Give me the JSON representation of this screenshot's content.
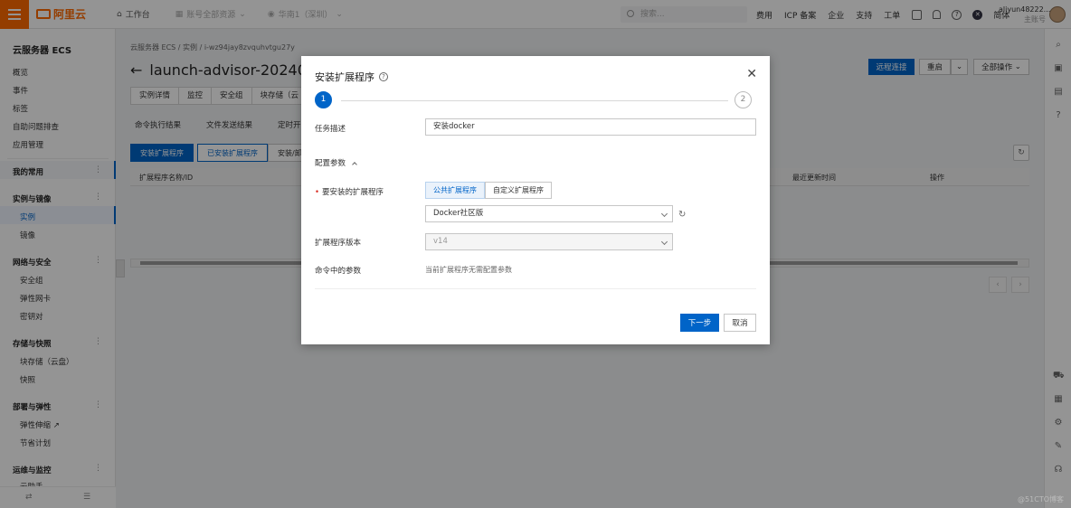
{
  "topbar": {
    "logo": "阿里云",
    "workbench": "工作台",
    "account": "账号全部资源",
    "region": "华南1（深圳）",
    "search_placeholder": "搜索...",
    "links": [
      "费用",
      "ICP 备案",
      "企业",
      "支持",
      "工单"
    ],
    "lang": "简体",
    "user": "aliyun48222...",
    "user_sub": "主账号"
  },
  "sidebar": {
    "title": "云服务器 ECS",
    "top_items": [
      "概览",
      "事件",
      "标签",
      "自助问题排查",
      "应用管理"
    ],
    "groups": [
      {
        "label": "我的常用",
        "items": []
      },
      {
        "label": "实例与镜像",
        "items": [
          "实例",
          "镜像"
        ]
      },
      {
        "label": "网络与安全",
        "items": [
          "安全组",
          "弹性网卡",
          "密钥对"
        ]
      },
      {
        "label": "存储与快照",
        "items": [
          "块存储（云盘）",
          "快照"
        ]
      },
      {
        "label": "部署与弹性",
        "items": [
          "弹性伸缩",
          "节省计划"
        ]
      },
      {
        "label": "运维与监控",
        "items": [
          "云助手"
        ]
      }
    ]
  },
  "main": {
    "breadcrumb": "云服务器 ECS  /  实例  /  i-wz94jay8zvquhvtgu27y",
    "title": "launch-advisor-20240906",
    "remote_btn": "远程连接",
    "restart_btn": "重启",
    "all_ops_btn": "全部操作",
    "tabs": [
      "实例详情",
      "监控",
      "安全组",
      "块存储（云"
    ],
    "subnav": [
      "命令执行结果",
      "文件发送结果",
      "定时开关机"
    ],
    "subtabs": [
      "安装扩展程序",
      "已安装扩展程序",
      "安装/卸载历"
    ],
    "table_headers": [
      "扩展程序名称/ID",
      "最近更新时间",
      "操作"
    ]
  },
  "modal": {
    "title": "安装扩展程序",
    "step1": "1",
    "step2": "2",
    "task_desc_label": "任务描述",
    "task_desc_value": "安装docker",
    "config_label": "配置参数",
    "ext_label": "要安装的扩展程序",
    "seg_public": "公共扩展程序",
    "seg_custom": "自定义扩展程序",
    "ext_value": "Docker社区版",
    "version_label": "扩展程序版本",
    "version_value": "v14",
    "params_label": "命令中的参数",
    "params_hint": "当前扩展程序无需配置参数",
    "next_btn": "下一步",
    "cancel_btn": "取消"
  },
  "watermark": "@51CTO博客",
  "colors": {
    "primary": "#0064c8",
    "brand": "#ff6a00"
  }
}
